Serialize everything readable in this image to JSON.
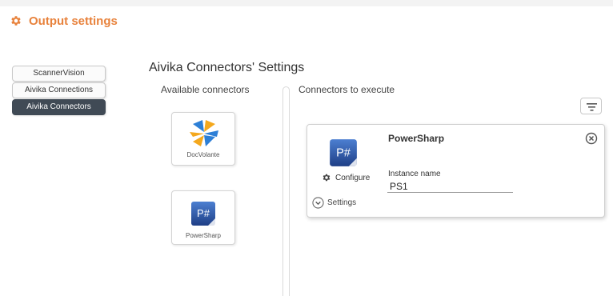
{
  "header": {
    "title": "Output settings",
    "icon": "gear-icon",
    "accent": "#e8823c"
  },
  "menu": {
    "items": [
      {
        "label": "ScannerVision"
      },
      {
        "label": "Aivika Connections"
      },
      {
        "label": "Aivika Connectors"
      }
    ],
    "active_color": "#404a55"
  },
  "main": {
    "title": "Aivika Connectors' Settings",
    "available_title": "Available connectors",
    "execute_title": "Connectors to execute"
  },
  "available": [
    {
      "label": "DocVolante",
      "icon": "docvolante-logo-icon"
    },
    {
      "label": "PowerSharp",
      "icon": "powersharp-logo-icon"
    }
  ],
  "execute": {
    "card": {
      "name": "PowerSharp",
      "configure_label": "Configure",
      "instance_label": "Instance name",
      "instance_value": "PS1",
      "settings_label": "Settings"
    }
  },
  "icons": {
    "logo_glyph": "P#"
  }
}
